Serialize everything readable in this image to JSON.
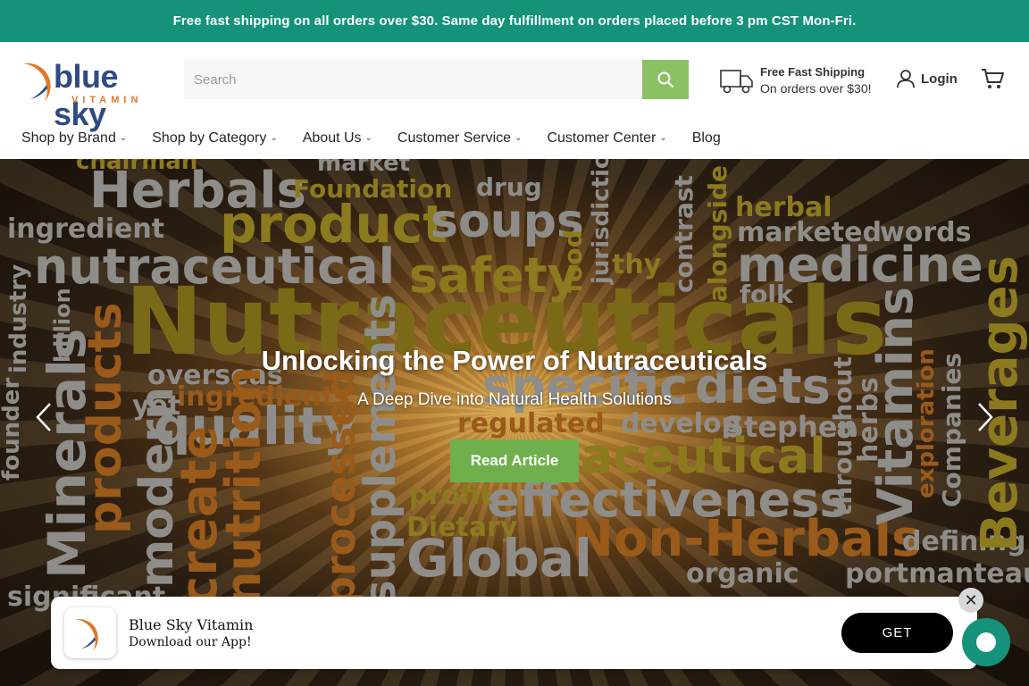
{
  "announcement": "Free fast shipping on all orders over $30. Same day fulfillment on orders placed before 3 pm CST Mon-Fri.",
  "logo": {
    "text": "blue sky",
    "sub": "VITAMIN"
  },
  "search": {
    "placeholder": "Search"
  },
  "shipping": {
    "title": "Free Fast Shipping",
    "subtitle": "On orders over $30!"
  },
  "account": {
    "login_label": "Login"
  },
  "nav": [
    {
      "label": "Shop by Brand"
    },
    {
      "label": "Shop by Category"
    },
    {
      "label": "About Us"
    },
    {
      "label": "Customer Service"
    },
    {
      "label": "Customer Center"
    },
    {
      "label": "Blog"
    }
  ],
  "hero": {
    "title": "Unlocking the Power of Nutraceuticals",
    "subtitle": "A Deep Dive into Natural Health Solutions",
    "button": "Read Article",
    "words": [
      "Herbals",
      "Foundation",
      "drug",
      "market",
      "chairman",
      "product",
      "soups",
      "herbal",
      "marketed",
      "words",
      "ingredient",
      "nutraceutical",
      "safety",
      "thy",
      "medicine",
      "folk",
      "Nutraceuticals",
      "overseas",
      "specific",
      "diets",
      "ingredients",
      "yet",
      "quality",
      "regulated",
      "develop",
      "Stephen",
      "aceutical",
      "effectiveness",
      "profit",
      "Dietary",
      "Non-Herbals",
      "defining",
      "Global",
      "organic",
      "portmanteau",
      "significant",
      "Minerals",
      "products",
      "modern",
      "create",
      "nutrition",
      "processed",
      "supplements",
      "Beverages",
      "Vitamins",
      "throughout",
      "herbs",
      "Companies",
      "exploration",
      "founder",
      "industry",
      "billion",
      "contrast",
      "alongside",
      "jurisdiction",
      "food"
    ]
  },
  "app_banner": {
    "name": "Blue Sky Vitamin",
    "desc": "Download our App!",
    "button": "GET"
  },
  "colors": {
    "brand_green": "#14937a",
    "accent_green": "#8cc163",
    "button_green": "#6fb04d",
    "logo_blue": "#2f4b84",
    "logo_orange": "#e0792b"
  }
}
